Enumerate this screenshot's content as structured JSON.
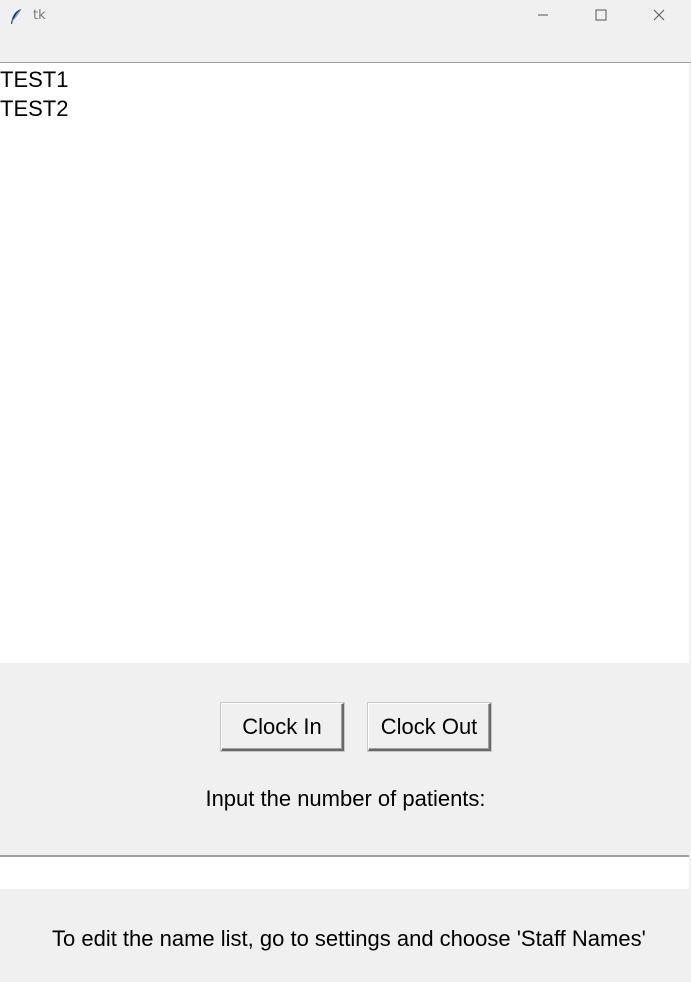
{
  "window": {
    "title": "tk",
    "icon": "feather-icon",
    "controls": {
      "minimize": "minimize-icon",
      "maximize": "maximize-icon",
      "close": "close-icon"
    }
  },
  "staff_list": {
    "items": [
      "TEST1",
      "TEST2"
    ]
  },
  "actions": {
    "clock_in_label": "Clock In",
    "clock_out_label": "Clock Out"
  },
  "patients": {
    "prompt": "Input the number of patients:",
    "value": ""
  },
  "footer": {
    "info": "To edit the name list, go to settings and choose 'Staff Names'"
  }
}
